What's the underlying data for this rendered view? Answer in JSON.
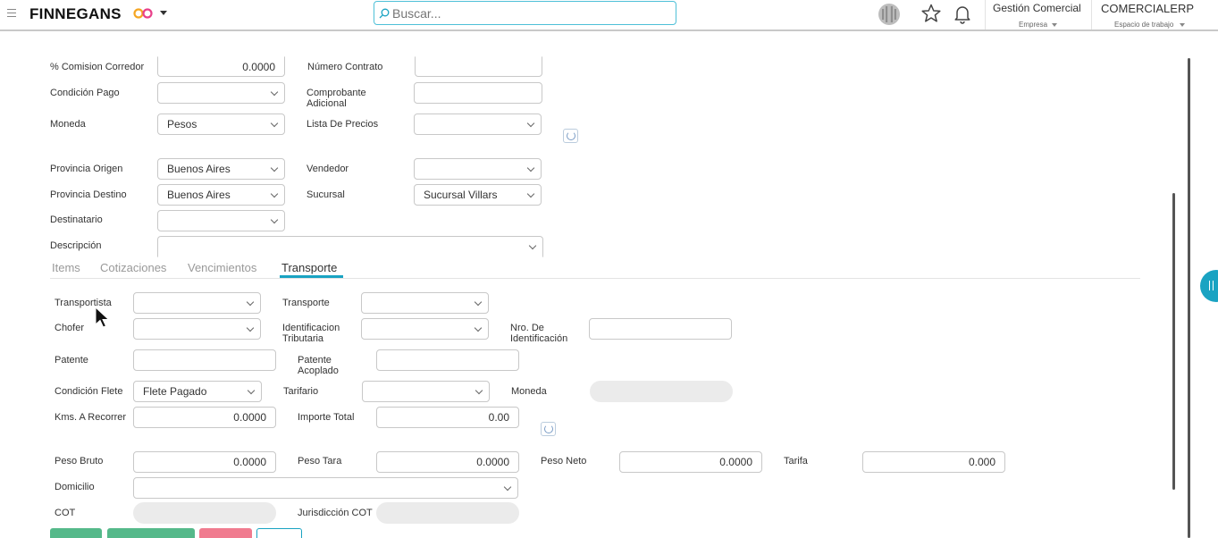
{
  "header": {
    "brand": "FINNEGANS",
    "search_placeholder": "Buscar...",
    "company_title": "Gestión Comercial",
    "company_sub": "Empresa",
    "workspace_title": "COMERCIALERP",
    "workspace_sub": "Espacio de trabajo"
  },
  "form": {
    "comision_label": "% Comision Corredor",
    "comision_value": "0.0000",
    "numero_contrato_label": "Número Contrato",
    "numero_contrato_value": "",
    "condicion_pago_label": "Condición Pago",
    "condicion_pago_value": "",
    "comprobante_label": "Comprobante Adicional",
    "comprobante_value": "",
    "moneda_label": "Moneda",
    "moneda_value": "Pesos",
    "lista_precios_label": "Lista De Precios",
    "lista_precios_value": "",
    "provincia_origen_label": "Provincia Origen",
    "provincia_origen_value": "Buenos Aires",
    "vendedor_label": "Vendedor",
    "vendedor_value": "",
    "provincia_destino_label": "Provincia Destino",
    "provincia_destino_value": "Buenos Aires",
    "sucursal_label": "Sucursal",
    "sucursal_value": "Sucursal Villars",
    "destinatario_label": "Destinatario",
    "destinatario_value": "",
    "descripcion_label": "Descripción",
    "descripcion_value": ""
  },
  "tabs": [
    {
      "label": "Items"
    },
    {
      "label": "Cotizaciones"
    },
    {
      "label": "Vencimientos"
    },
    {
      "label": "Transporte"
    }
  ],
  "transporte": {
    "transportista_label": "Transportista",
    "transportista_value": "",
    "transporte_label": "Transporte",
    "transporte_value": "",
    "chofer_label": "Chofer",
    "chofer_value": "",
    "ident_trib_label": "Identificacion Tributaria",
    "ident_trib_value": "",
    "nro_ident_label": "Nro. De Identificación",
    "nro_ident_value": "",
    "patente_label": "Patente",
    "patente_value": "",
    "patente_acoplado_label": "Patente Acoplado",
    "patente_acoplado_value": "",
    "condicion_flete_label": "Condición Flete",
    "condicion_flete_value": "Flete Pagado",
    "tarifario_label": "Tarifario",
    "tarifario_value": "",
    "moneda_label": "Moneda",
    "moneda_value": "",
    "kms_label": "Kms. A Recorrer",
    "kms_value": "0.0000",
    "importe_label": "Importe Total",
    "importe_value": "0.00",
    "peso_bruto_label": "Peso Bruto",
    "peso_bruto_value": "0.0000",
    "peso_tara_label": "Peso Tara",
    "peso_tara_value": "0.0000",
    "peso_neto_label": "Peso Neto",
    "peso_neto_value": "0.0000",
    "tarifa_label": "Tarifa",
    "tarifa_value": "0.000",
    "domicilio_label": "Domicilio",
    "domicilio_value": "",
    "cot_label": "COT",
    "cot_value": "",
    "jurisdiccion_label": "Jurisdicción COT",
    "jurisdiccion_value": ""
  },
  "colors": {
    "accent": "#1aa3c2",
    "button_green": "#55b98a",
    "button_pink": "#f07b8f"
  }
}
